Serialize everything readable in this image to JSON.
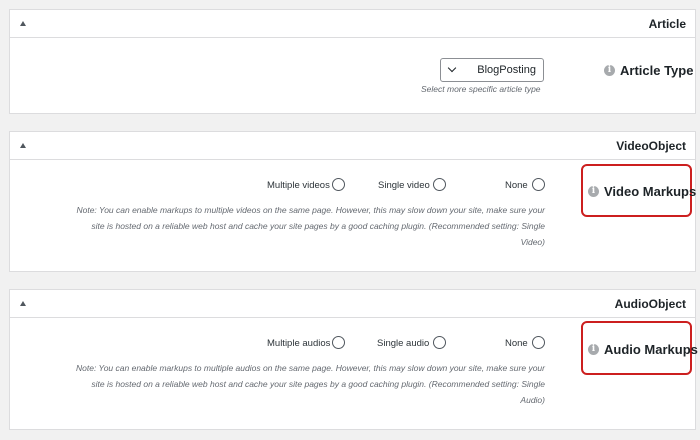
{
  "article": {
    "title": "Article",
    "setting_label": "Article Type",
    "select_value": "BlogPosting",
    "help_text": "Select more specific article type"
  },
  "video": {
    "title": "VideoObject",
    "setting_label": "Video Markups",
    "options": [
      "Multiple videos",
      "Single video",
      "None"
    ],
    "note_lines": [
      "Note: You can enable markups to multiple videos on the same page. However, this may slow down your site, make sure your",
      "site is hosted on a reliable web host and cache your site pages by a good caching plugin. (Recommended setting: Single",
      "Video)"
    ]
  },
  "audio": {
    "title": "AudioObject",
    "setting_label": "Audio Markups",
    "options": [
      "Multiple audios",
      "Single audio",
      "None"
    ],
    "note_lines": [
      "Note: You can enable markups to multiple audios on the same page. However, this may slow down your site, make sure your",
      "site is hosted on a reliable web host and cache your site pages by a good caching plugin. (Recommended setting: Single",
      "Audio)"
    ]
  },
  "icons": {
    "collapse": "triangle-up-icon",
    "info": "info-icon",
    "select": "chevron-down-icon"
  },
  "colors": {
    "highlight": "#cc1f1f",
    "panel_border": "#dcdcde",
    "background": "#f1f1f1"
  }
}
